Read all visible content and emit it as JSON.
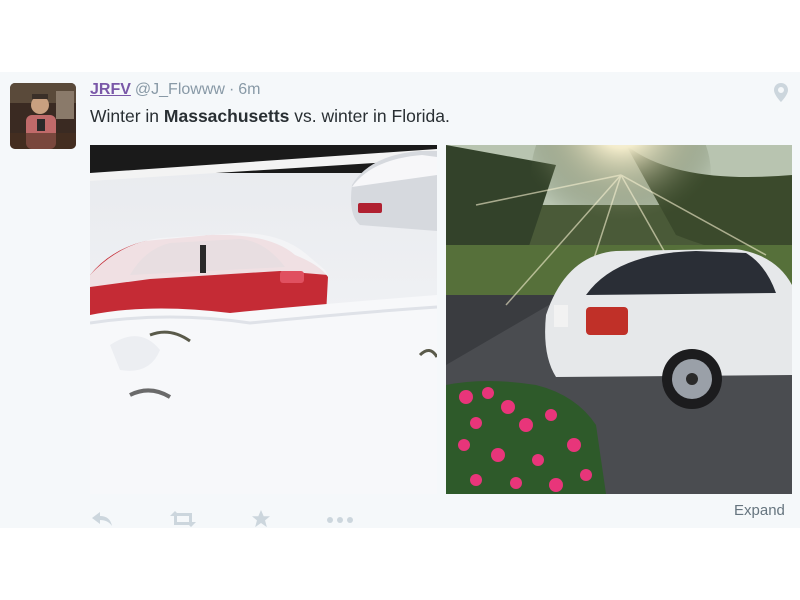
{
  "tweet": {
    "author": {
      "display_name": "JRFV",
      "handle": "@J_Flowww",
      "separator": "·",
      "time": "6m"
    },
    "text": {
      "part1": "Winter in ",
      "bold": "Massachusetts",
      "part2": " vs. winter in Florida."
    },
    "photos": [
      {
        "subject": "red car buried in snow"
      },
      {
        "subject": "white sedan in sunny driveway with pink flowers"
      }
    ],
    "actions": [
      "reply-icon",
      "retweet-icon",
      "favorite-icon",
      "more-icon"
    ],
    "expand_label": "Expand"
  },
  "colors": {
    "card_bg": "#f5f8fa",
    "name": "#7a58a8",
    "meta": "#8899a6",
    "text": "#292f33",
    "icon": "#ccd6dd"
  }
}
